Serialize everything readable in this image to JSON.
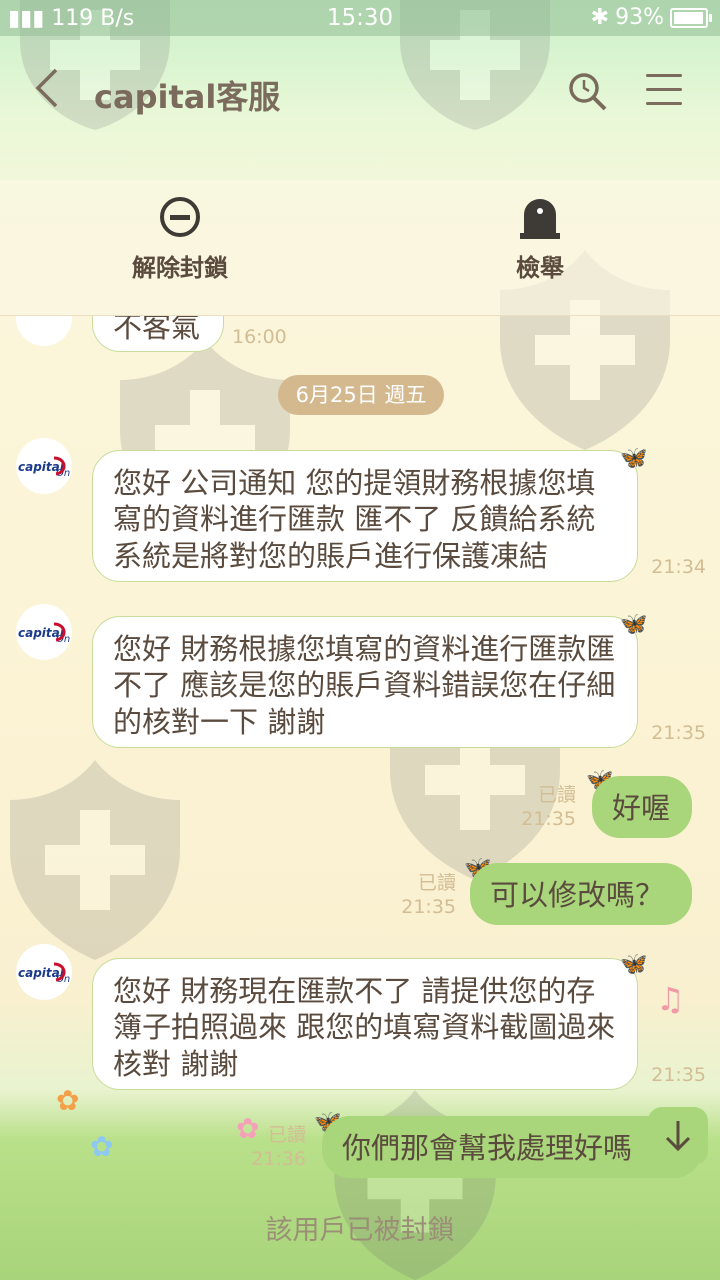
{
  "status": {
    "network": "119 B/s",
    "time": "15:30",
    "battery": "93%"
  },
  "header": {
    "title": "capital客服"
  },
  "actions": {
    "unblock": "解除封鎖",
    "report": "檢舉"
  },
  "chat": {
    "prev_message": {
      "text": "不客氣",
      "time": "16:00"
    },
    "date_label": "6月25日 週五",
    "messages": [
      {
        "text": "您好 公司通知 您的提領財務根據您填寫的資料進行匯款 匯不了 反饋給系統系統是將對您的賬戶進行保護凍結",
        "time": "21:34"
      },
      {
        "text": "您好 財務根據您填寫的資料進行匯款匯不了 應該是您的賬戶資料錯誤您在仔細的核對一下 謝謝",
        "time": "21:35"
      },
      {
        "text": "好喔",
        "read": "已讀",
        "time": "21:35"
      },
      {
        "text": "可以修改嗎？",
        "read": "已讀",
        "time": "21:35"
      },
      {
        "text": "您好 財務現在匯款不了 請提供您的存簿子拍照過來 跟您的填寫資料截圖過來核對 謝謝",
        "time": "21:35"
      },
      {
        "text": "你們那會幫我處理好嗎",
        "read": "已讀",
        "time": "21:36"
      }
    ]
  },
  "footer": {
    "blocked_text": "該用戶已被封鎖"
  },
  "avatar_logo": "capital On",
  "colors": {
    "accent_green": "#a9d67a",
    "text_brown": "#5a4b3e",
    "time_tan": "#d3bd94",
    "date_pill": "#d4b98f"
  },
  "icons": [
    "back-icon",
    "search-icon",
    "menu-icon",
    "unblock-icon",
    "report-icon",
    "scroll-down-icon",
    "butterfly-icon"
  ]
}
